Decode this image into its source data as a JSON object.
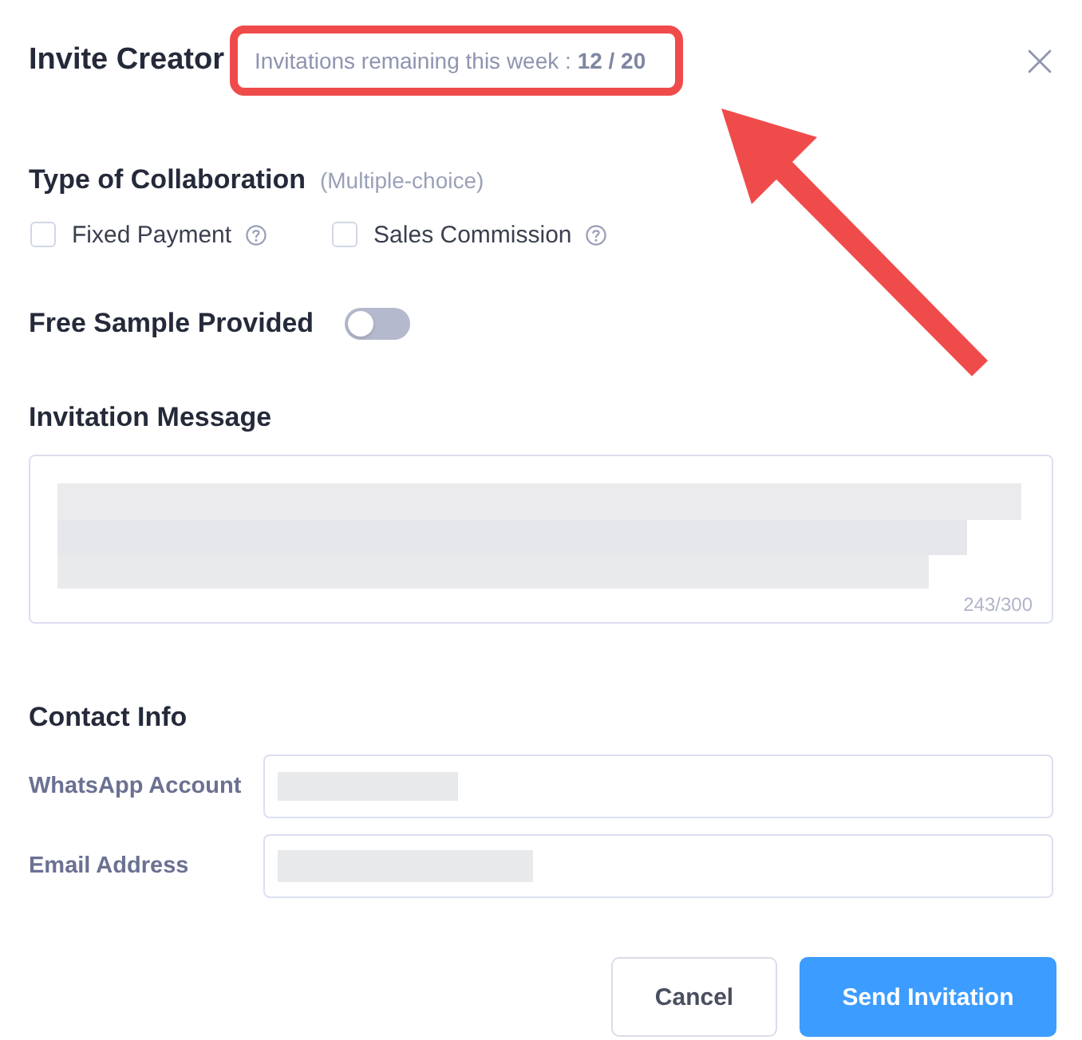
{
  "dialog": {
    "title": "Invite Creator",
    "quota": {
      "text": "Invitations remaining this week : **12 / 20**",
      "highlighted": true
    }
  },
  "collaboration": {
    "title": "Type of Collaboration",
    "hint": "(Multiple-choice)",
    "options": [
      {
        "label": "Fixed Payment",
        "checked": false,
        "help": true
      },
      {
        "label": "Sales Commission",
        "checked": false,
        "help": true
      }
    ]
  },
  "free_sample": {
    "label": "Free Sample Provided",
    "on": false
  },
  "message": {
    "title": "Invitation Message",
    "redacted": true,
    "counter": "243/300"
  },
  "contact": {
    "title": "Contact Info",
    "fields": [
      {
        "label": "WhatsApp Account",
        "redacted": true
      },
      {
        "label": "Email Address",
        "redacted": true
      }
    ]
  },
  "buttons": [
    {
      "label": "Cancel",
      "kind": "secondary"
    },
    {
      "label": "Send Invitation",
      "kind": "primary"
    }
  ],
  "annotations": [
    {
      "kind": "arrow"
    }
  ]
}
